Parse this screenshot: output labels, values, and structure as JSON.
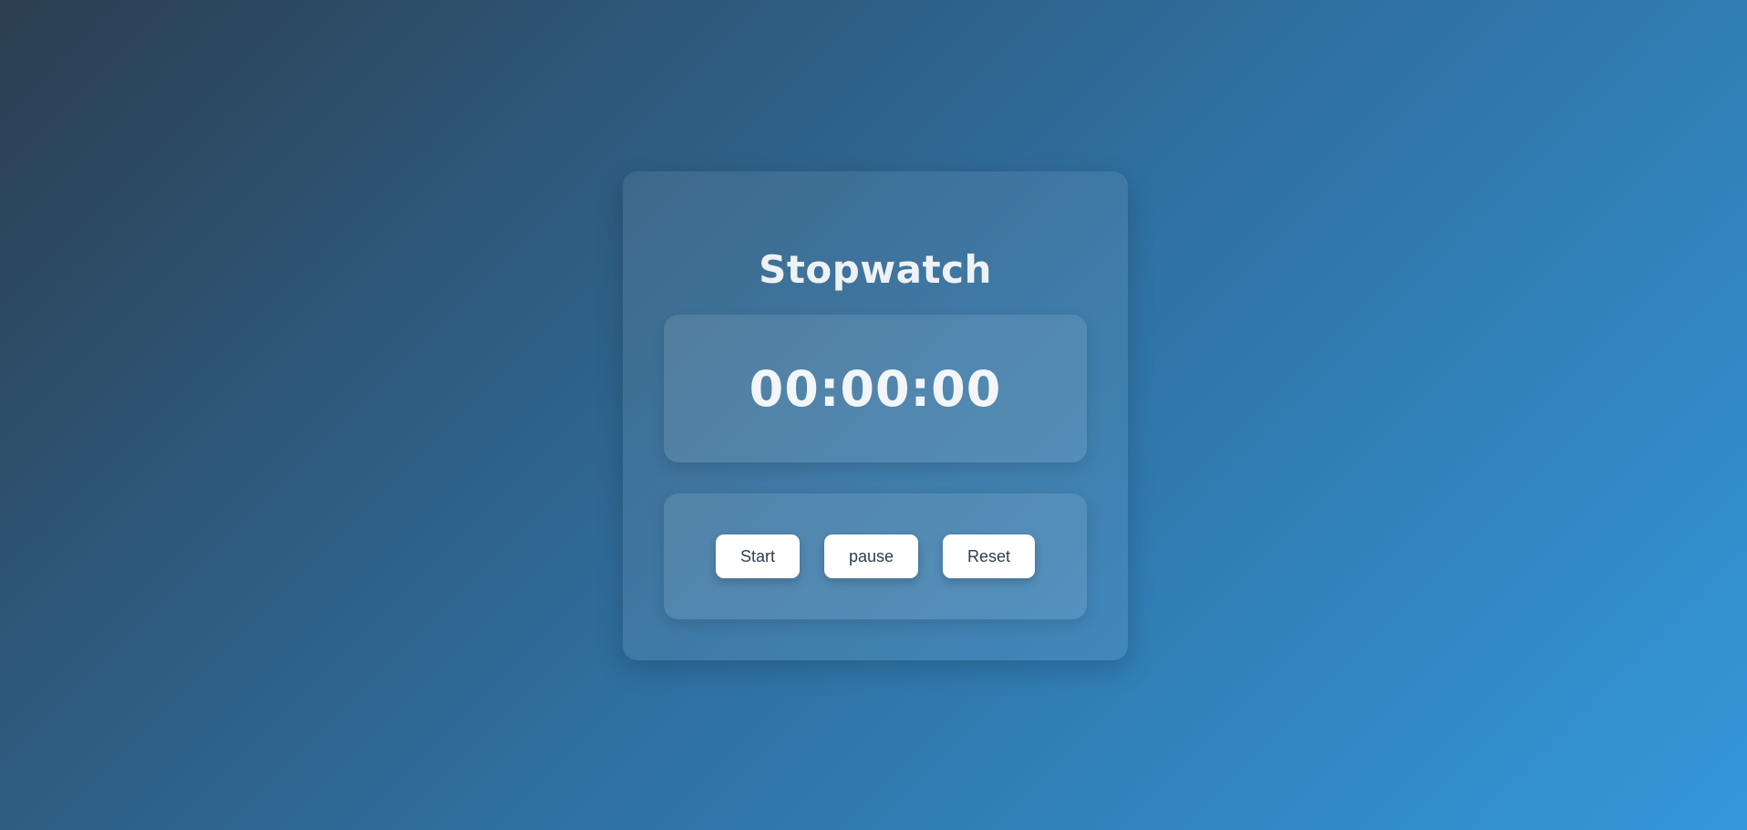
{
  "app": {
    "title": "Stopwatch"
  },
  "display": {
    "time": "00:00:00"
  },
  "controls": {
    "start_label": "Start",
    "pause_label": "pause",
    "reset_label": "Reset"
  },
  "colors": {
    "background_start": "#2c3e50",
    "background_end": "#3498db",
    "button_bg": "#ffffff",
    "button_text": "#2c3e50",
    "text": "#eef2f5"
  }
}
